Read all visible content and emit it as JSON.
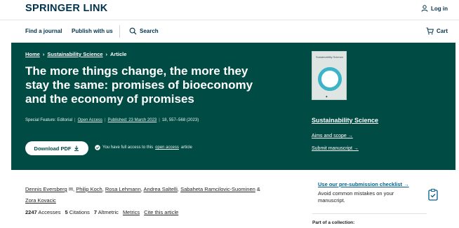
{
  "header": {
    "logo": "SPRINGER LINK",
    "login_label": "Log in"
  },
  "nav": {
    "find_journal": "Find a journal",
    "publish": "Publish with us",
    "search": "Search",
    "cart": "Cart"
  },
  "hero": {
    "breadcrumb": [
      "Home",
      "Sustainability Science",
      "Article"
    ],
    "title": "The more things change, the more they stay the same: promises of bioeconomy and the economy of promises",
    "meta": {
      "feature": "Special Feature: Editorial",
      "access": "Open Access",
      "published": "Published: 23 March 2023",
      "citation": "18, 557–568 (2023)"
    },
    "download_label": "Download PDF",
    "access_prefix": "You have full access to this",
    "access_link": "open access",
    "access_suffix": "article"
  },
  "journal": {
    "cover_title": "Sustainability Science",
    "name": "Sustainability Science",
    "aims": "Aims and scope →",
    "submit": "Submit manuscript →"
  },
  "article": {
    "authors": [
      "Dennis Eversberg",
      "Philip Koch",
      "Rosa Lehmann",
      "Andrea Saltelli",
      "Sabaheta Ramcilovic-Suominen",
      "Zora Kovacic"
    ],
    "authors_and": "&",
    "stats": {
      "accesses_value": "2247",
      "accesses_label": "Accesses",
      "citations_value": "5",
      "citations_label": "Citations",
      "altmetric_value": "7",
      "altmetric_label": "Altmetric",
      "metrics": "Metrics",
      "cite": "Cite this article"
    }
  },
  "sidebar": {
    "checklist_title": "Use our pre-submission checklist →",
    "checklist_sub": "Avoid common mistakes on your manuscript.",
    "collection_label": "Part of a collection:"
  },
  "colors": {
    "hero_bg": "#004b44",
    "brand_navy": "#01324b",
    "link_blue": "#025e8d"
  }
}
